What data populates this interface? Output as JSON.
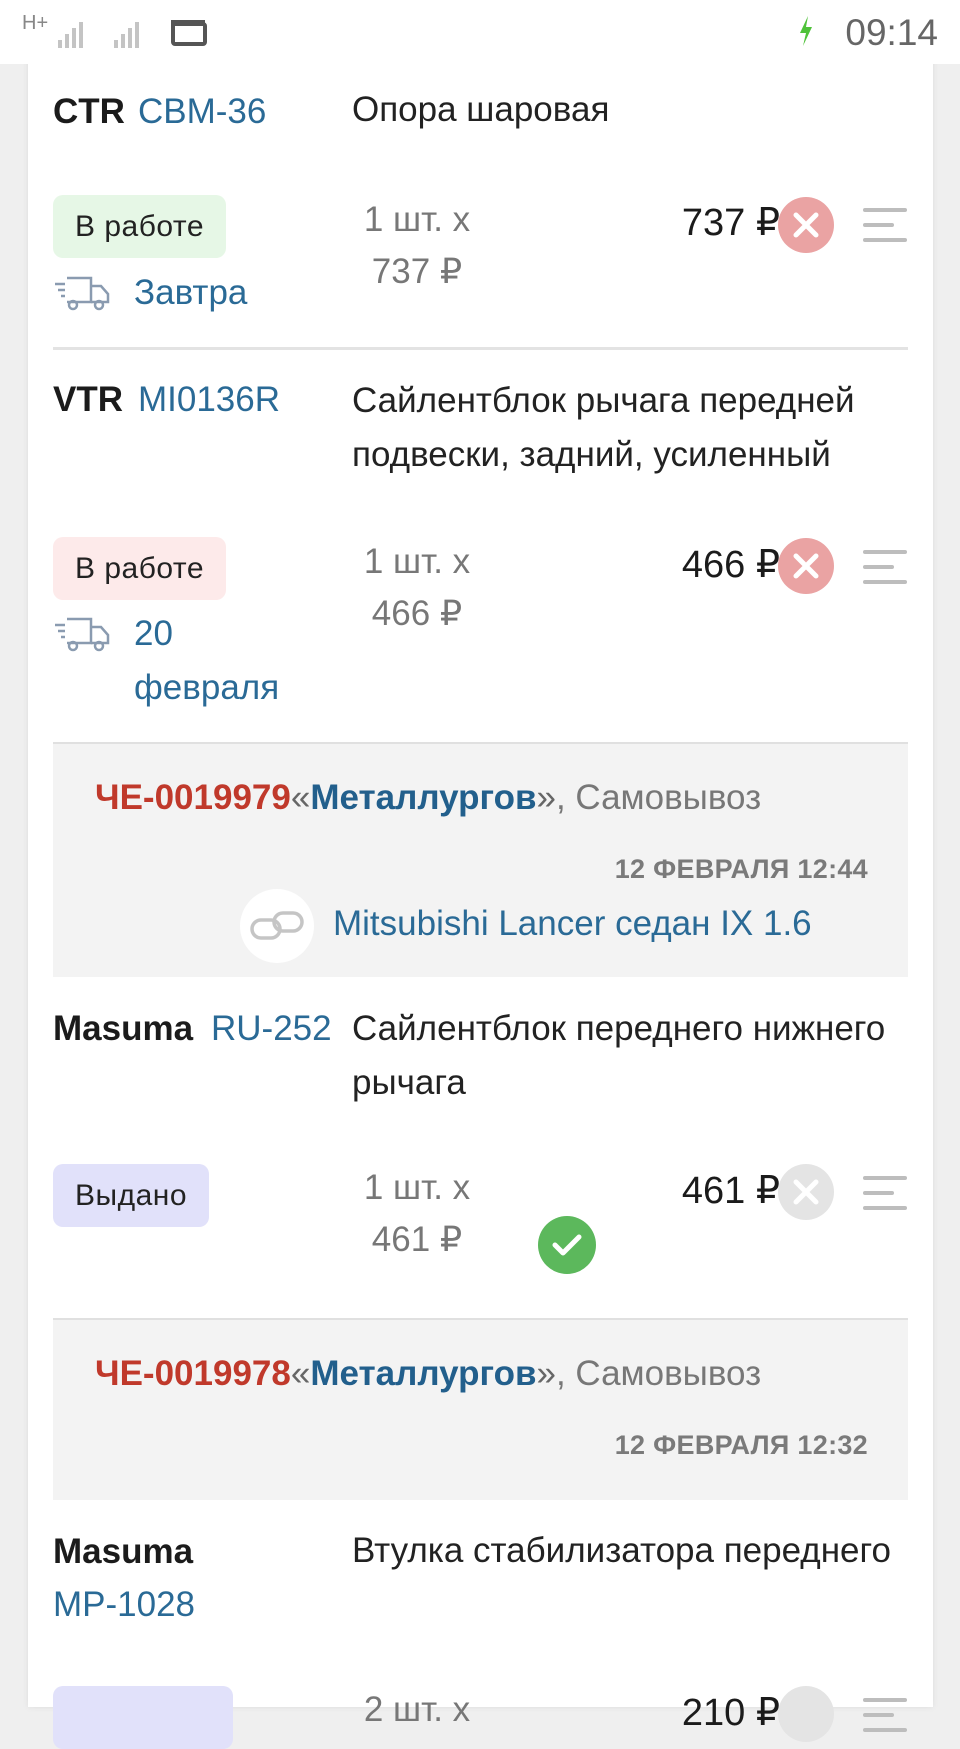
{
  "status_bar": {
    "network": "H+",
    "time": "09:14",
    "icons": [
      "signal-icon",
      "signal-icon",
      "sim-card-icon",
      "charging-icon"
    ]
  },
  "items": [
    {
      "brand": "CTR",
      "article": "CBM-36",
      "name": "Опора шаровая",
      "status": "В работе",
      "delivery": "Завтра",
      "qty_line1": "1 шт. х",
      "qty_line2": "737 ₽",
      "total": "737 ₽"
    },
    {
      "brand": "VTR",
      "article": "MI0136R",
      "name": "Сайлентблок рычага передней подвески, задний, усиленный",
      "status": "В работе",
      "delivery": "20 февраля",
      "qty_line1": "1 шт. х",
      "qty_line2": "466 ₽",
      "total": "466 ₽"
    },
    {
      "brand": "Masuma",
      "article": "RU-252",
      "name": "Сайлентблок переднего нижнего рычага",
      "status": "Выдано",
      "qty_line1": "1 шт. х",
      "qty_line2": "461 ₽",
      "total": "461 ₽"
    },
    {
      "brand": "Masuma",
      "article": "MP-1028",
      "name": "Втулка стабилизатора переднего",
      "qty_line1": "2 шт. х",
      "total": "210 ₽"
    }
  ],
  "orders": [
    {
      "id": "ЧЕ-0019979",
      "quote_open": "«",
      "store": "Металлургов",
      "quote_close": "»",
      "pickup": ", Самовывоз",
      "date": "12 ФЕВРАЛЯ 12:44",
      "car": "Mitsubishi Lancer седан IX 1.6"
    },
    {
      "id": "ЧЕ-0019978",
      "quote_open": "«",
      "store": "Металлургов",
      "quote_close": "»",
      "pickup": ", Самовывоз",
      "date": "12 ФЕВРАЛЯ 12:32"
    }
  ],
  "colors": {
    "order_id": "#c0392b",
    "link": "#2a6a96",
    "status_in_work_green": "#e6f7e6",
    "status_in_work_pink": "#fdeaea",
    "status_issued": "#e1e1fa",
    "cancel_active": "#eaa3a3",
    "issued_check": "#5cb85c"
  }
}
